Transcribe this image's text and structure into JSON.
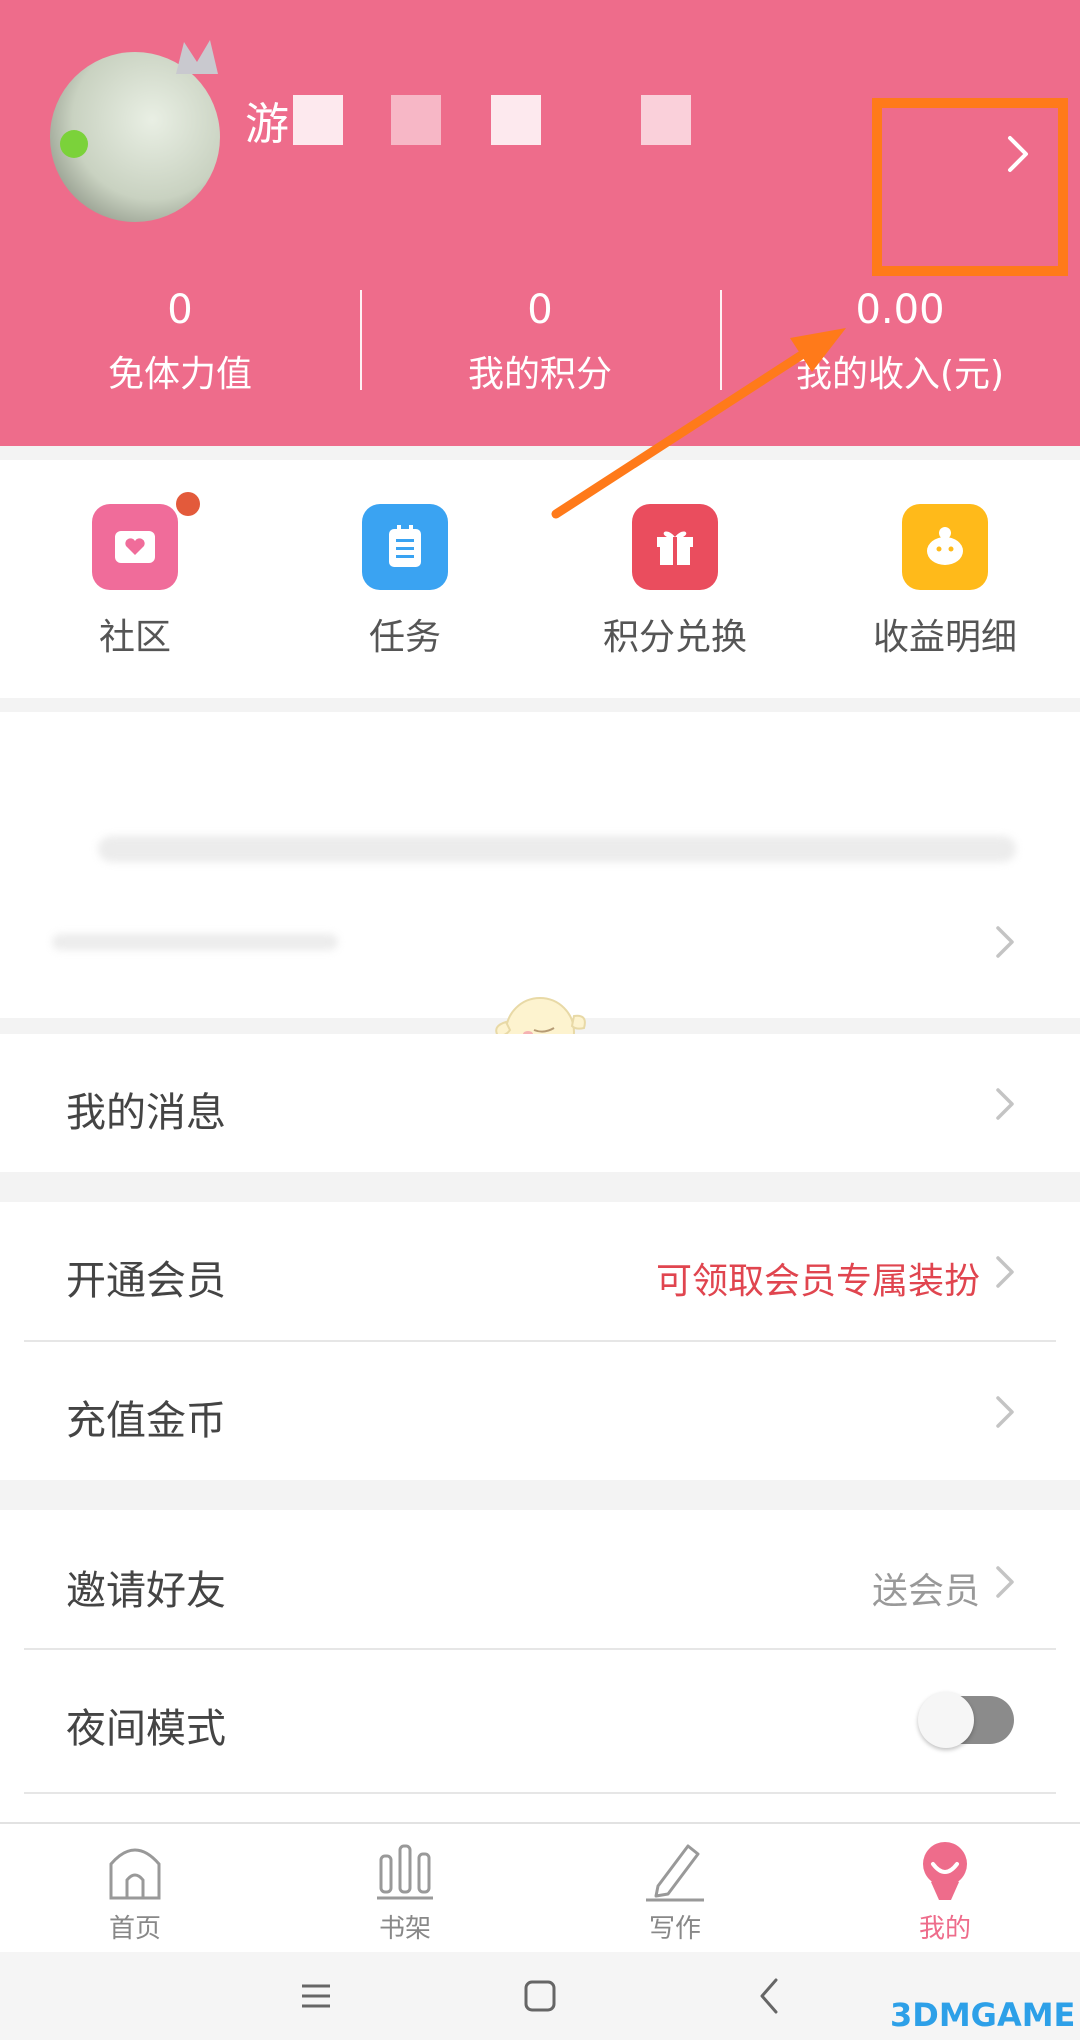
{
  "colors": {
    "header": "#ee6c8b",
    "accent": "#ee6c8b",
    "vip_text": "#e0454f",
    "highlight": "#ff7a1a"
  },
  "header": {
    "username_visible": "游",
    "stats": [
      {
        "value": "0",
        "label": "免体力值"
      },
      {
        "value": "0",
        "label": "我的积分"
      },
      {
        "value": "0.00",
        "label": "我的收入(元)"
      }
    ]
  },
  "quick_links": [
    {
      "label": "社区",
      "icon": "community-icon",
      "color": "#f06c9a"
    },
    {
      "label": "任务",
      "icon": "task-icon",
      "color": "#3aa3f2"
    },
    {
      "label": "积分兑换",
      "icon": "gift-icon",
      "color": "#ea4d5e"
    },
    {
      "label": "收益明细",
      "icon": "piggy-bank-icon",
      "color": "#ffba1a"
    }
  ],
  "menu": {
    "messages": {
      "title": "我的消息"
    },
    "vip": {
      "title": "开通会员",
      "hint": "可领取会员专属装扮"
    },
    "recharge": {
      "title": "充值金币"
    },
    "invite": {
      "title": "邀请好友",
      "hint": "送会员"
    },
    "night_mode": {
      "title": "夜间模式",
      "on": false
    }
  },
  "bottom_nav": [
    {
      "label": "首页",
      "icon": "home-icon"
    },
    {
      "label": "书架",
      "icon": "bookshelf-icon"
    },
    {
      "label": "写作",
      "icon": "pen-icon"
    },
    {
      "label": "我的",
      "icon": "profile-icon",
      "active": true
    }
  ],
  "watermark": "3DMGAME"
}
